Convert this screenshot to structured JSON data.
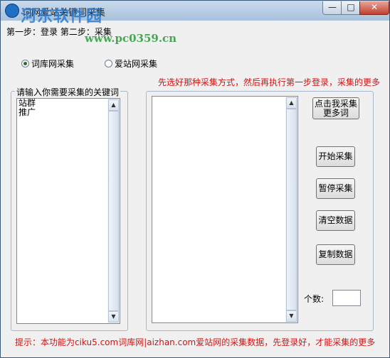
{
  "window": {
    "title": "词网爱站关键词采集",
    "minimize_glyph": "—",
    "maximize_glyph": "□",
    "close_glyph": "✕",
    "icon": "app-logo-icon"
  },
  "watermark": {
    "brand": "河东软件园",
    "url": "www.pc0359.cn"
  },
  "steps": {
    "label": "第一步：登录 第二步：采集"
  },
  "radios": {
    "ciku": {
      "label": "词库网采集",
      "checked": true
    },
    "aizhan": {
      "label": "爱站网采集",
      "checked": false
    }
  },
  "hint_top": "先选好那种采集方式，然后再执行第一步登录，采集的更多",
  "keywords": {
    "legend": "请输入你需要采集的关键词",
    "items": [
      "站群",
      "推广"
    ]
  },
  "results": {
    "items": []
  },
  "buttons": {
    "more_words_line1": "点击我采集",
    "more_words_line2": "更多词",
    "start": "开始采集",
    "pause": "暂停采集",
    "clear": "清空数据",
    "copy": "复制数据"
  },
  "count": {
    "label": "个数:",
    "value": ""
  },
  "hint_bottom": "提示：本功能为ciku5.com词库网|aizhan.com爱站网的采集数据，先登录好，才能采集的更多",
  "scroll": {
    "up_glyph": "▲",
    "down_glyph": "▼"
  }
}
